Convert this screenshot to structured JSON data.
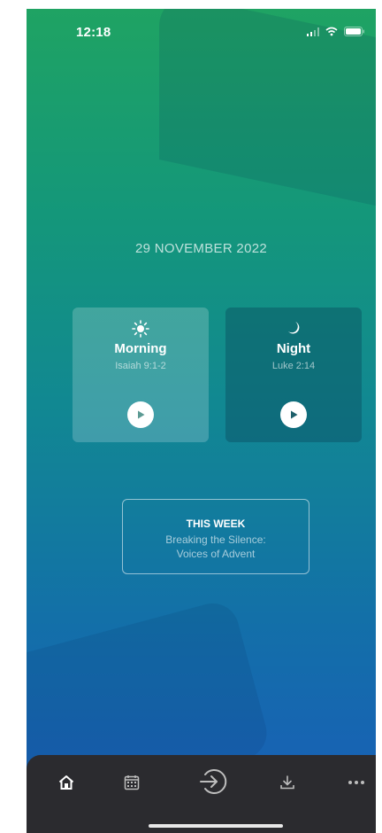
{
  "status_bar": {
    "time": "12:18"
  },
  "date": "29 NOVEMBER 2022",
  "cards": [
    {
      "name": "Morning",
      "reference": "Isaiah 9:1-2",
      "icon": "sun-icon"
    },
    {
      "name": "Night",
      "reference": "Luke 2:14",
      "icon": "moon-icon"
    }
  ],
  "this_week": {
    "heading": "THIS WEEK",
    "line1": "Breaking the Silence:",
    "line2": "Voices of Advent"
  },
  "tab_bar": {
    "items": [
      "home-icon",
      "calendar-icon",
      "enter-icon",
      "download-icon",
      "more-icon"
    ],
    "active": "home-icon"
  },
  "colors": {
    "gradient_top": "#1fa363",
    "gradient_bottom": "#1a5cb9",
    "tab_bar_bg": "#2b2b2f"
  }
}
